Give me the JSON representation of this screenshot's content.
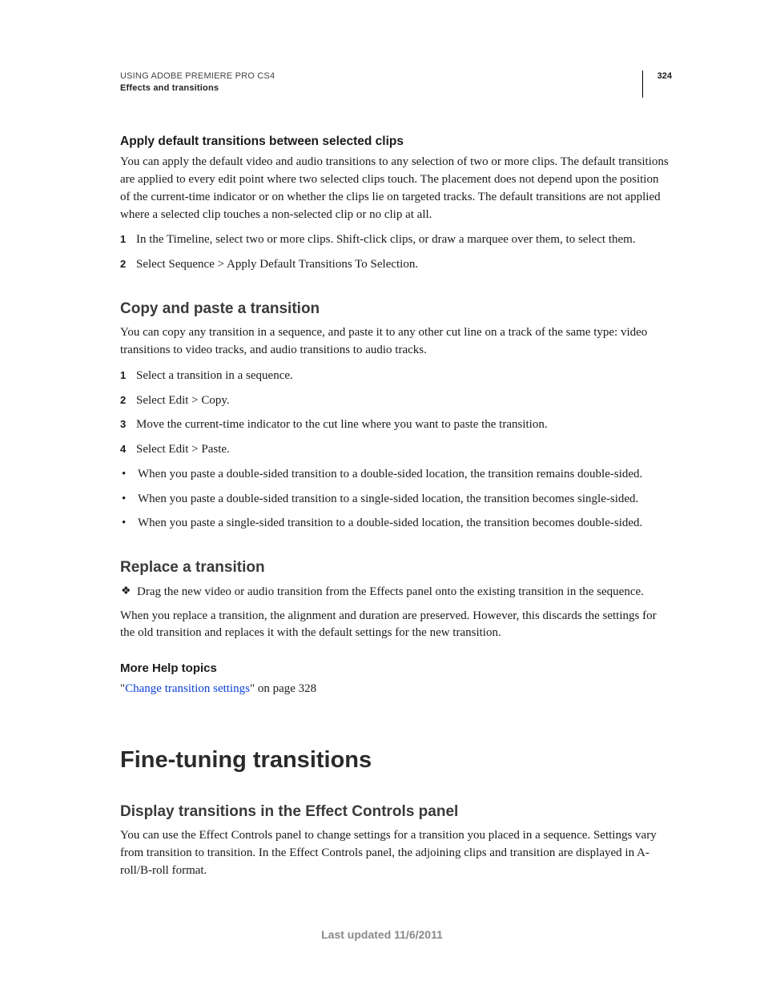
{
  "header": {
    "product": "USING ADOBE PREMIERE PRO CS4",
    "section": "Effects and transitions",
    "page_number": "324"
  },
  "s1": {
    "title": "Apply default transitions between selected clips",
    "body": "You can apply the default video and audio transitions to any selection of two or more clips. The default transitions are applied to every edit point where two selected clips touch. The placement does not depend upon the position of the current-time indicator or on whether the clips lie on targeted tracks. The default transitions are not applied where a selected clip touches a non-selected clip or no clip at all.",
    "step1": "In the Timeline, select two or more clips. Shift-click clips, or draw a marquee over them, to select them.",
    "step2": "Select Sequence > Apply Default Transitions To Selection."
  },
  "s2": {
    "title": "Copy and paste a transition",
    "body": "You can copy any transition in a sequence, and paste it to any other cut line on a track of the same type: video transitions to video tracks, and audio transitions to audio tracks.",
    "step1": "Select a transition in a sequence.",
    "step2": "Select Edit > Copy.",
    "step3": "Move the current-time indicator to the cut line where you want to paste the transition.",
    "step4": "Select Edit > Paste.",
    "b1": "When you paste a double-sided transition to a double-sided location, the transition remains double-sided.",
    "b2": "When you paste a double-sided transition to a single-sided location, the transition becomes single-sided.",
    "b3": "When you paste a single-sided transition to a double-sided location, the transition becomes double-sided."
  },
  "s3": {
    "title": "Replace a transition",
    "action": "Drag the new video or audio transition from the Effects panel onto the existing transition in the sequence.",
    "body": "When you replace a transition, the alignment and duration are preserved. However, this discards the settings for the old transition and replaces it with the default settings for the new transition."
  },
  "more": {
    "title": "More Help topics",
    "link_text": "Change transition settings",
    "suffix": "\" on page 328",
    "prefix": "\""
  },
  "s4": {
    "h1": "Fine-tuning transitions",
    "title": "Display transitions in the Effect Controls panel",
    "body": "You can use the Effect Controls panel to change settings for a transition you placed in a sequence. Settings vary from transition to transition. In the Effect Controls panel, the adjoining clips and transition are displayed in A-roll/B-roll format."
  },
  "nums": {
    "n1": "1",
    "n2": "2",
    "n3": "3",
    "n4": "4"
  },
  "footer": "Last updated 11/6/2011"
}
